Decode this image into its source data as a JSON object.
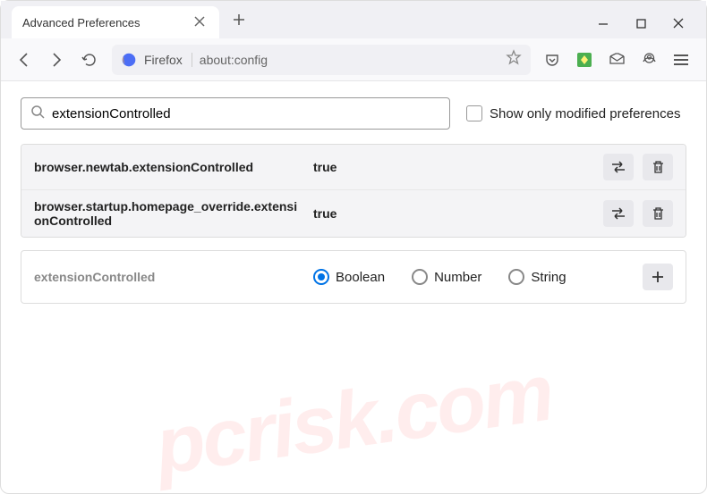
{
  "window": {
    "tab_title": "Advanced Preferences"
  },
  "toolbar": {
    "identity": "Firefox",
    "url": "about:config"
  },
  "search": {
    "value": "extensionControlled",
    "checkbox_label": "Show only modified preferences"
  },
  "prefs": [
    {
      "name": "browser.newtab.extensionControlled",
      "value": "true"
    },
    {
      "name": "browser.startup.homepage_override.extensionControlled",
      "value": "true"
    }
  ],
  "new_pref": {
    "name": "extensionControlled",
    "types": [
      "Boolean",
      "Number",
      "String"
    ]
  },
  "watermark": "pcrisk.com"
}
